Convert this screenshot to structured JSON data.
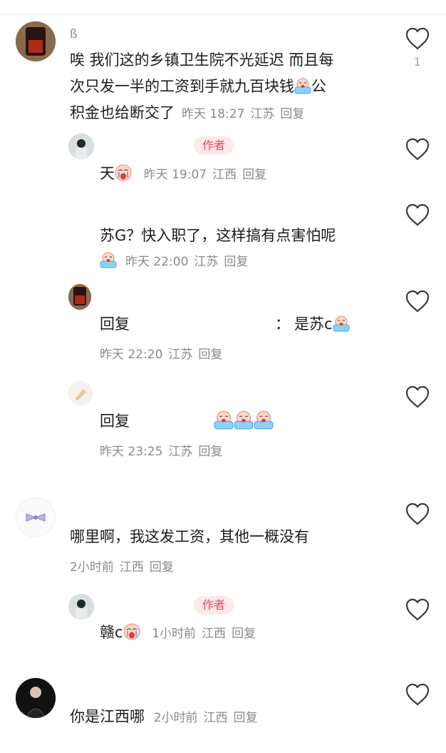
{
  "comments": [
    {
      "name": "ß",
      "text_line1": "唉 我们这的乡镇卫生院不光延迟 而且每",
      "text_line2": "次只发一半的工资到手就九百块钱",
      "text_line2b": "公",
      "text_line3": "积金也给断交了",
      "time": "昨天 18:27",
      "location": "江苏",
      "reply": "回复",
      "likes": "1",
      "replies": [
        {
          "badge": "作者",
          "text": "天",
          "time": "昨天 19:07",
          "location": "江西",
          "reply": "回复"
        },
        {
          "text": "苏G？快入职了，这样搞有点害怕呢",
          "time": "昨天 22:00",
          "location": "江苏",
          "reply": "回复"
        },
        {
          "prefix": "回复",
          "sep": "：",
          "text": "是苏c",
          "time": "昨天 22:20",
          "location": "江苏",
          "reply": "回复"
        },
        {
          "prefix": "回复",
          "time": "昨天 23:25",
          "location": "江苏",
          "reply": "回复"
        }
      ]
    },
    {
      "text": "哪里啊，我这发工资，其他一概没有",
      "time": "2小时前",
      "location": "江西",
      "reply": "回复",
      "replies": [
        {
          "badge": "作者",
          "text": "赣c",
          "time": "1小时前",
          "location": "江西",
          "reply": "回复"
        }
      ]
    },
    {
      "text": "你是江西哪",
      "time": "2小时前",
      "location": "江西",
      "reply": "回复"
    }
  ],
  "icons": {
    "like": "heart-icon",
    "cry": "crying-emoji-icon",
    "sob": "sobbing-emoji-icon"
  },
  "colors": {
    "badge_bg": "#fde8ea",
    "badge_text": "#f0455a",
    "meta": "#8a8a8a"
  }
}
